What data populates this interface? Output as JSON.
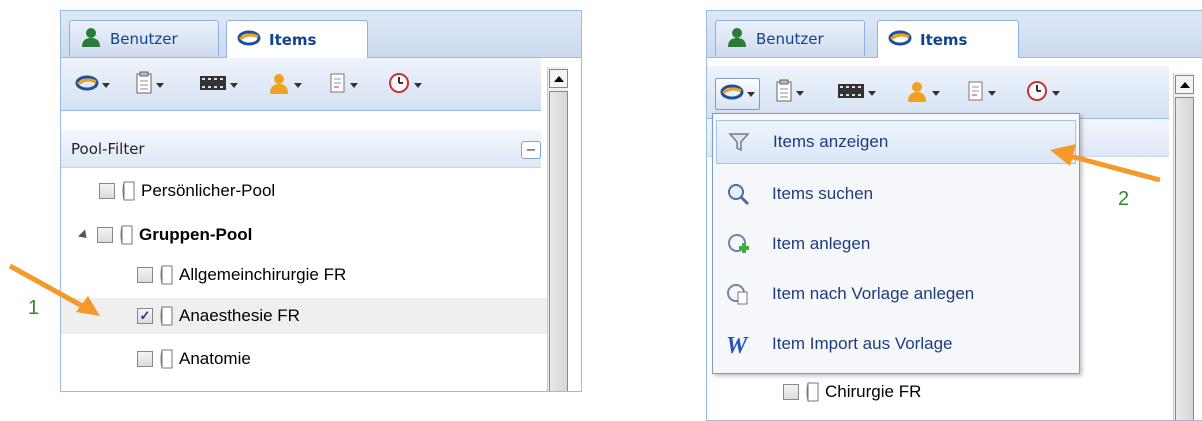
{
  "left_panel": {
    "tabs": [
      {
        "label": "Benutzer",
        "active": false
      },
      {
        "label": "Items",
        "active": true
      }
    ],
    "toolbar_icons": [
      "items-menu-icon",
      "clipboard-icon",
      "film-icon",
      "user-icon",
      "document-icon",
      "clock-icon"
    ],
    "filter_header": "Pool-Filter",
    "collapse_symbol": "−",
    "tree": [
      {
        "label": "Persönlicher-Pool",
        "checked": false,
        "level": 1,
        "bold": false
      },
      {
        "label": "Gruppen-Pool",
        "checked": false,
        "level": 0,
        "bold": true,
        "expanded": true
      },
      {
        "label": "Allgemeinchirurgie FR",
        "checked": false,
        "level": 2,
        "bold": false
      },
      {
        "label": "Anaesthesie FR",
        "checked": true,
        "level": 2,
        "bold": false,
        "selected": true
      },
      {
        "label": "Anatomie",
        "checked": false,
        "level": 2,
        "bold": false
      }
    ]
  },
  "right_panel": {
    "tabs": [
      {
        "label": "Benutzer",
        "active": false
      },
      {
        "label": "Items",
        "active": true
      }
    ],
    "background_row": "Chirurgie FR",
    "menu": [
      {
        "label": "Items anzeigen",
        "icon": "filter-icon",
        "active": true
      },
      {
        "label": "Items suchen",
        "icon": "magnifier-icon",
        "active": false
      },
      {
        "label": "Item anlegen",
        "icon": "add-item-icon",
        "active": false
      },
      {
        "label": "Item nach Vorlage anlegen",
        "icon": "copy-item-icon",
        "active": false
      },
      {
        "label": "Item Import aus Vorlage",
        "icon": "word-icon",
        "active": false
      }
    ]
  },
  "annotations": {
    "step1": "1",
    "step2": "2"
  },
  "colors": {
    "arrow": "#f39a2a",
    "annotation_text": "#2f8a2f",
    "panel_border": "#99bbe8",
    "menu_text": "#1f3d7a"
  }
}
